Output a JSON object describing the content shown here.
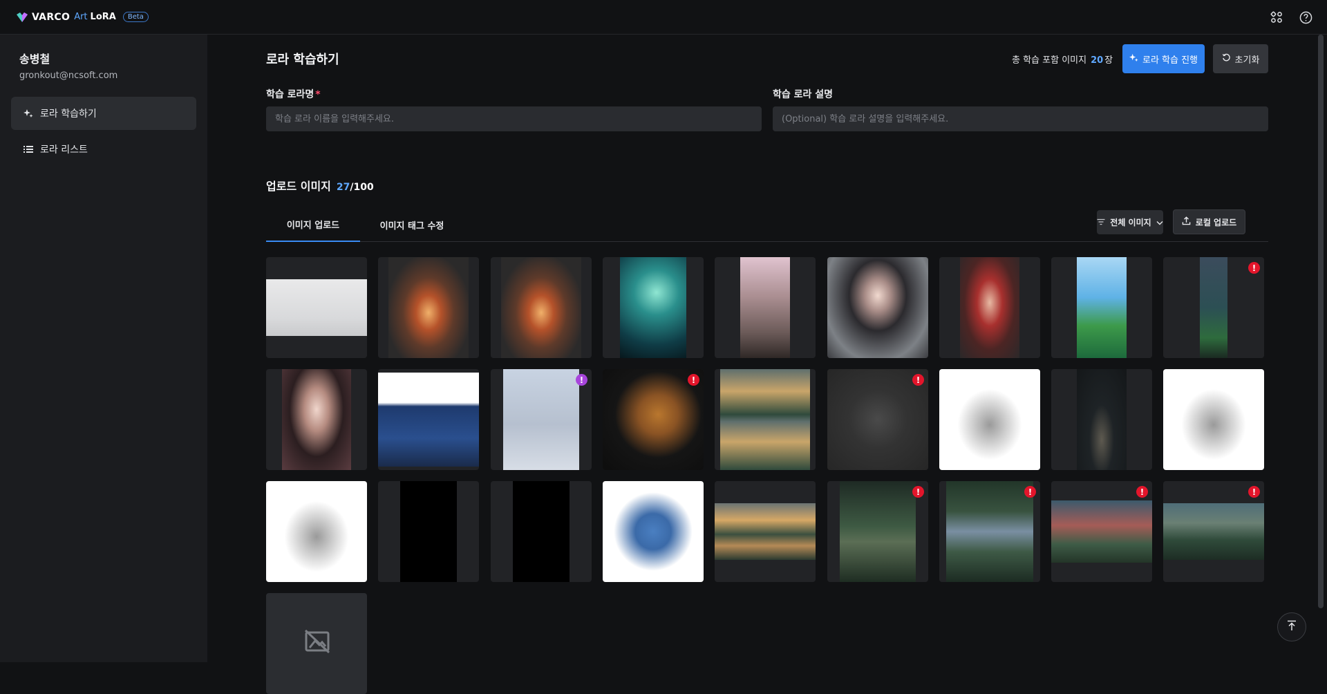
{
  "app": {
    "brand": "VARCO",
    "brand_art": "Art",
    "brand_lora": "LoRA",
    "beta": "Beta",
    "icons": [
      "apps-grid-icon",
      "help-circle-icon"
    ]
  },
  "sidebar": {
    "user_name": "송병철",
    "user_email": "gronkout@ncsoft.com",
    "items": [
      {
        "label": "로라 학습하기",
        "icon": "sparkle-icon",
        "active": true
      },
      {
        "label": "로라 리스트",
        "icon": "list-icon",
        "active": false
      }
    ]
  },
  "header": {
    "title": "로라 학습하기",
    "total_label": "총 학습 포함 이미지",
    "total_count": "20",
    "total_unit": "장",
    "train_button": "로라 학습 진행",
    "reset_button": "초기화"
  },
  "form": {
    "name_label": "학습 로라명",
    "name_required": "*",
    "name_placeholder": "학습 로라 이름을 입력해주세요.",
    "name_value": "",
    "desc_label": "학습 로라 설명",
    "desc_placeholder": "(Optional) 학습 로라 설명을 입력해주세요.",
    "desc_value": ""
  },
  "upload": {
    "title": "업로드 이미지",
    "current": "27",
    "separator": "/",
    "max": "100",
    "tabs": [
      {
        "label": "이미지 업로드",
        "active": true
      },
      {
        "label": "이미지 태그 수정",
        "active": false
      }
    ],
    "filter_label": "전체 이미지",
    "local_upload_label": "로컬 업로드"
  },
  "images": [
    {
      "name": "portrait-man-photo",
      "warning": null
    },
    {
      "name": "autumn-forest-road",
      "warning": null
    },
    {
      "name": "autumn-forest-road-2",
      "warning": null
    },
    {
      "name": "anime-underwater-girl",
      "warning": null
    },
    {
      "name": "european-street-alley",
      "warning": null
    },
    {
      "name": "dark-armor-girl",
      "warning": null
    },
    {
      "name": "red-dress-warrior",
      "warning": null
    },
    {
      "name": "meadow-landscape",
      "warning": null
    },
    {
      "name": "dark-landscape-strip",
      "warning": "!"
    },
    {
      "name": "rose-girl-portrait",
      "warning": null
    },
    {
      "name": "nc-executives",
      "warning": null
    },
    {
      "name": "3d-pose-model",
      "warning": "!"
    },
    {
      "name": "brown-bear-character",
      "warning": "!"
    },
    {
      "name": "lake-mountain-reflection",
      "warning": null
    },
    {
      "name": "knight-statue",
      "warning": "!"
    },
    {
      "name": "warrior-lineart",
      "warning": null
    },
    {
      "name": "dark-knight-figure",
      "warning": null
    },
    {
      "name": "warrior-lineart-2",
      "warning": null
    },
    {
      "name": "warrior-lineart-3",
      "warning": null
    },
    {
      "name": "openpose-skeleton",
      "warning": null
    },
    {
      "name": "black-mask",
      "warning": null
    },
    {
      "name": "blue-alien-character",
      "warning": null
    },
    {
      "name": "lake-mountain-wide",
      "warning": null
    },
    {
      "name": "misty-valley",
      "warning": "!"
    },
    {
      "name": "waterfall-valley",
      "warning": "!"
    },
    {
      "name": "sunset-cliff",
      "warning": "!"
    },
    {
      "name": "cloud-mountain",
      "warning": "!"
    },
    {
      "name": "missing-image",
      "warning": null
    }
  ],
  "colors": {
    "accent": "#2f80ed",
    "warning": "#e3152b",
    "warning_alt": "#a845dc",
    "background": "#111214",
    "sidebar": "#1b1c1f"
  }
}
